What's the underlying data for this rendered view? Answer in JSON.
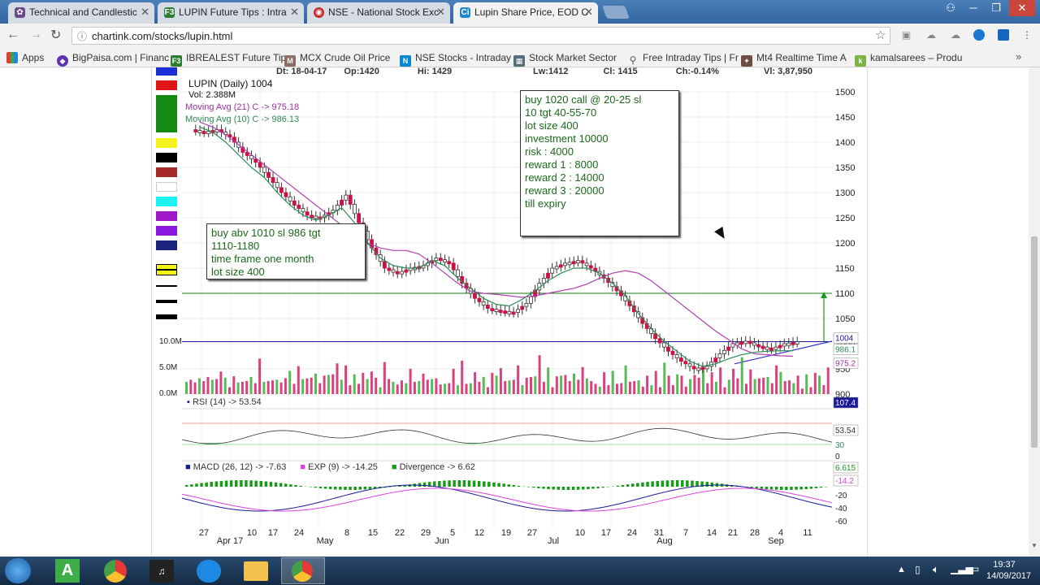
{
  "browser": {
    "tabs": [
      {
        "title": "Technical and Candlestic",
        "icon": "gear-icon",
        "color": "#6b4b8c"
      },
      {
        "title": "LUPIN Future Tips : Intra",
        "icon": "f3-icon",
        "color": "#2e7d32"
      },
      {
        "title": "NSE - National Stock Exc",
        "icon": "nse-icon",
        "color": "#c62828"
      },
      {
        "title": "Lupin Share Price, EOD C",
        "icon": "ci-icon",
        "color": "#1e88c8",
        "active": true
      }
    ],
    "url": "chartink.com/stocks/lupin.html",
    "bookmarks": [
      {
        "label": "Apps"
      },
      {
        "label": "BigPaisa.com | Financ"
      },
      {
        "label": "IBREALEST Future Tip"
      },
      {
        "label": "MCX Crude Oil Price"
      },
      {
        "label": "NSE Stocks - Intraday"
      },
      {
        "label": "Stock Market Sector"
      },
      {
        "label": "Free Intraday Tips | Fr"
      },
      {
        "label": "Mt4 Realtime Time A"
      },
      {
        "label": "kamalsarees – Produ"
      }
    ]
  },
  "chart": {
    "header": {
      "dt": "Dt: 18-04-17",
      "op": "Op:1420",
      "hi": "Hi: 1429",
      "lw": "Lw:1412",
      "cl": "Cl: 1415",
      "ch": "Ch:-0.14%",
      "vl": "Vl: 3,87,950"
    },
    "symbol": "LUPIN (Daily) 1004",
    "vol": "Vol: 2.388M",
    "ma21": "Moving Avg (21) C -> 975.18",
    "ma10": "Moving Avg (10) C -> 986.13",
    "rsi_label": "RSI (14) -> 53.54",
    "macd_label": "MACD (26, 12) -> -7.63",
    "exp_label": "EXP (9) -> -14.25",
    "div_label": "Divergence -> 6.62",
    "price_ticks": [
      "1500",
      "1450",
      "1400",
      "1350",
      "1300",
      "1250",
      "1200",
      "1150",
      "1100",
      "1050",
      "1000",
      "950",
      "900"
    ],
    "volume_ticks": [
      "10.0M",
      "5.0M",
      "0.0M"
    ],
    "macd_ticks": [
      "0",
      "20",
      "0",
      "-20",
      "-40",
      "-60"
    ],
    "right_badges": {
      "price": "1004",
      "ma1": "986.1",
      "ma2": "975.2",
      "vol": "107.4",
      "rsi1": "53.54",
      "rsi2": "30",
      "macd1": "6.615",
      "macd2": "-14.2"
    },
    "x_day_labels": [
      "27",
      "10",
      "17",
      "24",
      "8",
      "15",
      "22",
      "29",
      "5",
      "12",
      "19",
      "27",
      "10",
      "17",
      "24",
      "31",
      "7",
      "14",
      "21",
      "28",
      "4",
      "11"
    ],
    "x_month_labels": [
      "Apr 17",
      "May",
      "Jun",
      "Jul",
      "Aug",
      "Sep"
    ],
    "note1": [
      "buy 1020 call @ 20-25 sl",
      "10 tgt 40-55-70",
      "lot size 400",
      "investment 10000",
      "risk : 4000",
      "reward 1 : 8000",
      "reward 2 : 14000",
      "reward 3 : 20000",
      "till expiry"
    ],
    "note2": [
      "buy abv 1010 sl 986 tgt",
      "1110-1180",
      "time frame one month",
      "lot size 400"
    ],
    "colors": {
      "up": "#ffffff",
      "down": "#cc1144",
      "ma10": "#2e8b57",
      "ma21": "#b040b0",
      "macd": "#1a1a99",
      "exp": "#e040e0",
      "divergence": "#169c16",
      "volume": "#cc1144"
    }
  },
  "chart_data": {
    "type": "candlestick",
    "title": "LUPIN (Daily) 1004",
    "ylim": [
      900,
      1500
    ],
    "series": [
      {
        "name": "Moving Avg (21) C",
        "values": [
          1440,
          1430,
          1415,
          1395,
          1375,
          1355,
          1335,
          1315,
          1295,
          1275,
          1255,
          1235,
          1215,
          1200,
          1190,
          1185,
          1185,
          1178,
          1160,
          1140,
          1120,
          1104,
          1100,
          1098,
          1095,
          1092,
          1095,
          1100,
          1105,
          1110,
          1118,
          1130,
          1140,
          1145,
          1140,
          1125,
          1105,
          1085,
          1065,
          1045,
          1025,
          1008,
          990,
          980,
          978,
          976,
          975
        ]
      },
      {
        "name": "Moving Avg (10) C",
        "values": [
          1430,
          1420,
          1400,
          1375,
          1350,
          1330,
          1300,
          1275,
          1255,
          1245,
          1255,
          1270,
          1240,
          1200,
          1170,
          1155,
          1150,
          1150,
          1165,
          1155,
          1130,
          1110,
          1090,
          1078,
          1075,
          1088,
          1105,
          1125,
          1140,
          1150,
          1150,
          1140,
          1120,
          1095,
          1060,
          1030,
          1005,
          985,
          965,
          955,
          960,
          970,
          978,
          983,
          985,
          986,
          986
        ]
      }
    ],
    "close": [
      1420,
      1425,
      1410,
      1380,
      1360,
      1330,
      1300,
      1275,
      1255,
      1250,
      1265,
      1295,
      1240,
      1190,
      1150,
      1140,
      1150,
      1155,
      1170,
      1160,
      1120,
      1090,
      1070,
      1065,
      1062,
      1080,
      1120,
      1150,
      1160,
      1165,
      1150,
      1130,
      1105,
      1075,
      1040,
      1010,
      985,
      965,
      950,
      955,
      980,
      1000,
      1005,
      995,
      990,
      1000,
      1004
    ]
  }
}
